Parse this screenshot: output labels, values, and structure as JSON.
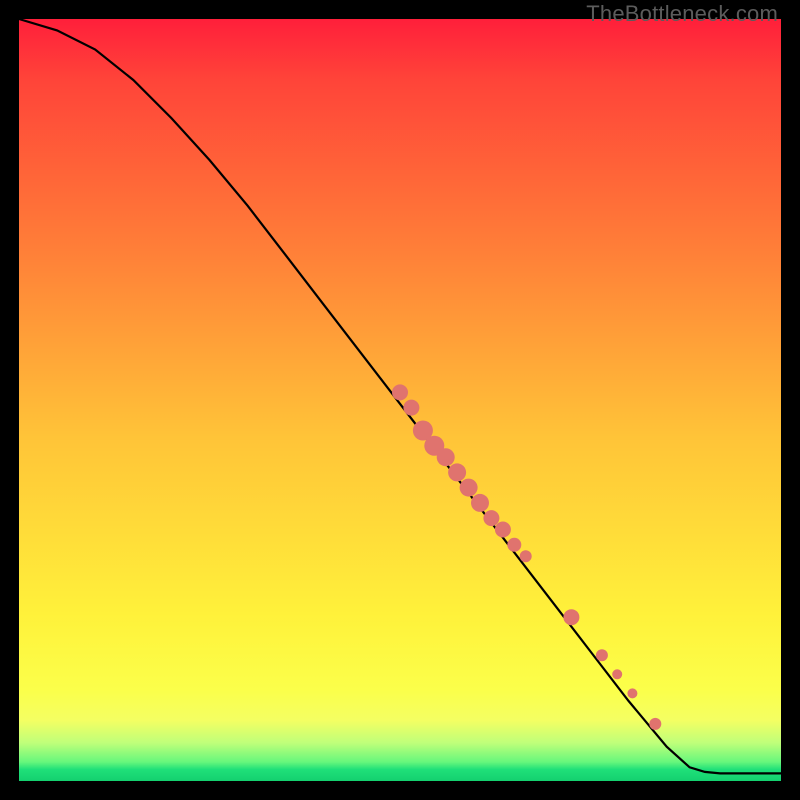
{
  "watermark": "TheBottleneck.com",
  "colors": {
    "background": "#000000",
    "curve": "#000000",
    "point_fill": "#e0736e",
    "point_stroke": "#d35a55"
  },
  "chart_data": {
    "type": "line",
    "title": "",
    "xlabel": "",
    "ylabel": "",
    "xlim": [
      0,
      100
    ],
    "ylim": [
      0,
      100
    ],
    "series": [
      {
        "name": "curve",
        "x": [
          0,
          5,
          10,
          15,
          20,
          25,
          30,
          35,
          40,
          45,
          50,
          55,
          60,
          65,
          70,
          75,
          80,
          85,
          88,
          90,
          92,
          95,
          100
        ],
        "y": [
          100,
          98.5,
          96,
          92,
          87,
          81.5,
          75.5,
          69,
          62.5,
          56,
          49.5,
          43,
          36.5,
          30,
          23.5,
          17,
          10.5,
          4.5,
          1.8,
          1.2,
          1.0,
          1.0,
          1.0
        ]
      }
    ],
    "points": [
      {
        "x": 50.0,
        "y": 51.0,
        "r": 8
      },
      {
        "x": 51.5,
        "y": 49.0,
        "r": 8
      },
      {
        "x": 53.0,
        "y": 46.0,
        "r": 10
      },
      {
        "x": 54.5,
        "y": 44.0,
        "r": 10
      },
      {
        "x": 56.0,
        "y": 42.5,
        "r": 9
      },
      {
        "x": 57.5,
        "y": 40.5,
        "r": 9
      },
      {
        "x": 59.0,
        "y": 38.5,
        "r": 9
      },
      {
        "x": 60.5,
        "y": 36.5,
        "r": 9
      },
      {
        "x": 62.0,
        "y": 34.5,
        "r": 8
      },
      {
        "x": 63.5,
        "y": 33.0,
        "r": 8
      },
      {
        "x": 65.0,
        "y": 31.0,
        "r": 7
      },
      {
        "x": 66.5,
        "y": 29.5,
        "r": 6
      },
      {
        "x": 72.5,
        "y": 21.5,
        "r": 8
      },
      {
        "x": 76.5,
        "y": 16.5,
        "r": 6
      },
      {
        "x": 78.5,
        "y": 14.0,
        "r": 5
      },
      {
        "x": 80.5,
        "y": 11.5,
        "r": 5
      },
      {
        "x": 83.5,
        "y": 7.5,
        "r": 6
      }
    ]
  }
}
